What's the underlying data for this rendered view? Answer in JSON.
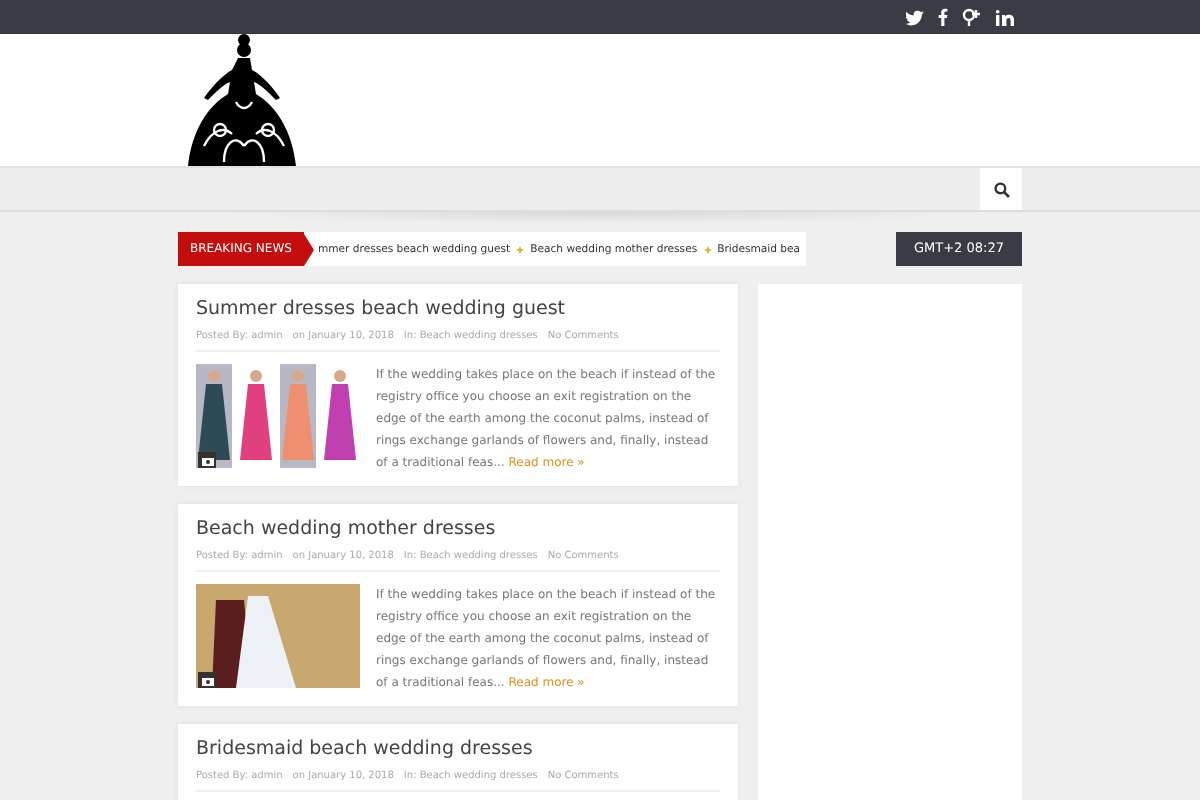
{
  "breaking_news": {
    "label": "BREAKING NEWS",
    "items": [
      "mmer dresses beach wedding guest",
      "Beach wedding mother dresses",
      "Bridesmaid bea"
    ]
  },
  "clock": "GMT+2 08:27",
  "posts": [
    {
      "title": "Summer dresses beach wedding guest",
      "meta": [
        "Posted By: admin",
        "on January 10, 2018",
        "In: Beach wedding dresses",
        "No Comments"
      ],
      "excerpt": "If the wedding takes place on the beach if instead of the registry office you choose an exit registration on the edge of the earth among the coconut palms, instead of rings exchange garlands of flowers and, finally, instead of a traditional feas...",
      "read_more": "Read more »"
    },
    {
      "title": "Beach wedding mother dresses",
      "meta": [
        "Posted By: admin",
        "on January 10, 2018",
        "In: Beach wedding dresses",
        "No Comments"
      ],
      "excerpt": "If the wedding takes place on the beach if instead of the registry office you choose an exit registration on the edge of the earth among the coconut palms, instead of rings exchange garlands of flowers and, finally, instead of a traditional feas...",
      "read_more": "Read more »"
    },
    {
      "title": "Bridesmaid beach wedding dresses",
      "meta": [
        "Posted By: admin",
        "on January 10, 2018",
        "In: Beach wedding dresses",
        "No Comments"
      ]
    }
  ]
}
